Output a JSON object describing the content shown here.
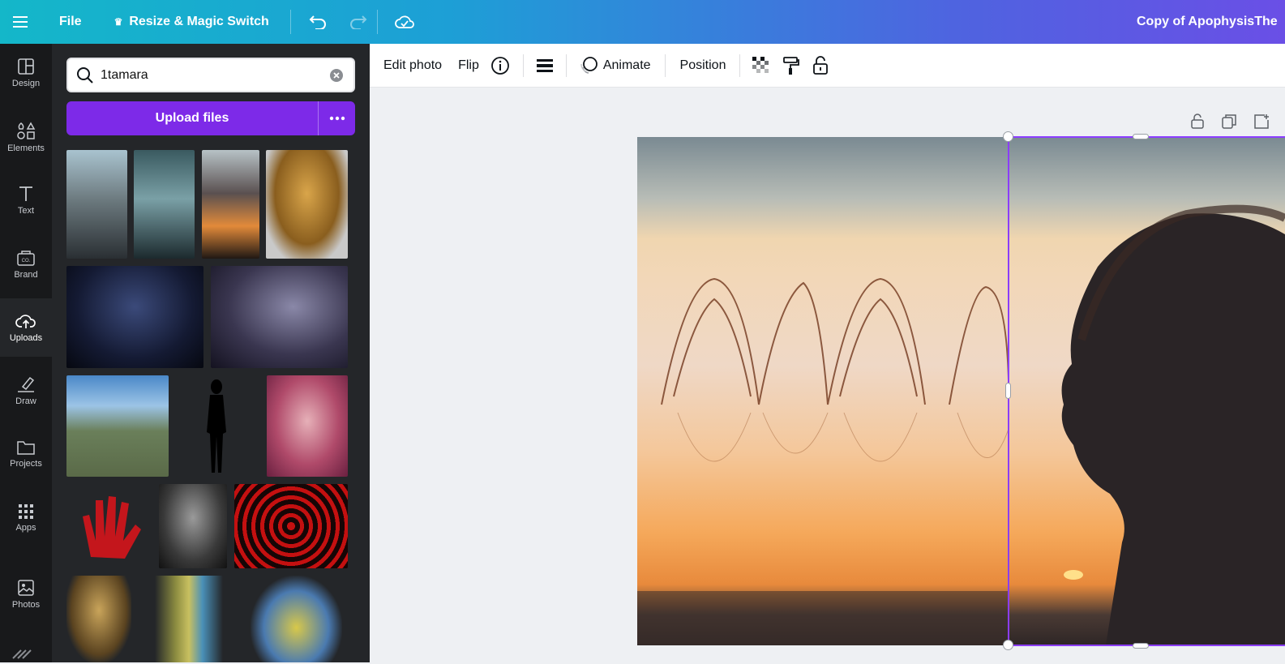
{
  "topbar": {
    "menu_icon": "hamburger-menu-icon",
    "file_label": "File",
    "resize_label": "Resize & Magic Switch",
    "doc_title": "Copy of ApophysisThe"
  },
  "rail": {
    "items": [
      {
        "label": "Design",
        "icon": "design-icon"
      },
      {
        "label": "Elements",
        "icon": "elements-icon"
      },
      {
        "label": "Text",
        "icon": "text-icon"
      },
      {
        "label": "Brand",
        "icon": "brand-icon"
      },
      {
        "label": "Uploads",
        "icon": "upload-cloud-icon",
        "active": true
      },
      {
        "label": "Draw",
        "icon": "draw-icon"
      },
      {
        "label": "Projects",
        "icon": "folder-icon"
      },
      {
        "label": "Apps",
        "icon": "apps-grid-icon"
      },
      {
        "label": "Photos",
        "icon": "photo-icon"
      }
    ]
  },
  "panel": {
    "search": {
      "value": "1tamara",
      "placeholder": "Search"
    },
    "upload_label": "Upload files"
  },
  "toolbar": {
    "edit_photo": "Edit photo",
    "flip": "Flip",
    "animate": "Animate",
    "position": "Position"
  },
  "colors": {
    "accent": "#7d2ae8",
    "rail_bg": "#18191b",
    "panel_bg": "#242629",
    "selection": "#8b3dff"
  }
}
